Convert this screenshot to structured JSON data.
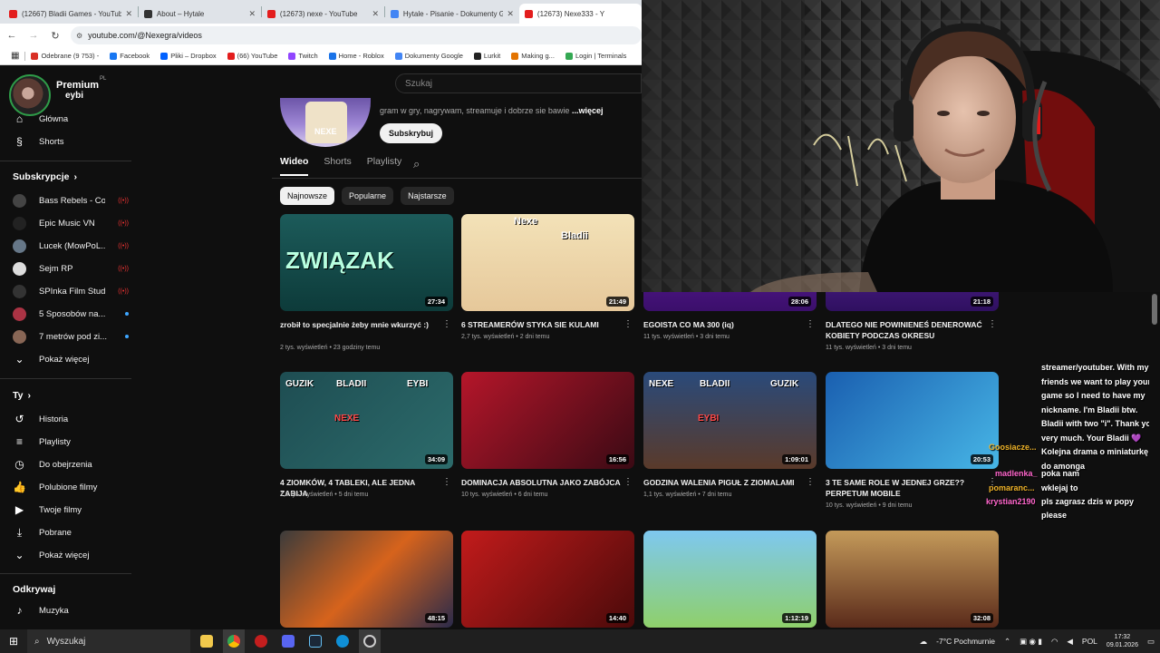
{
  "browser": {
    "tabs": [
      {
        "title": "(12667) Bladii Games - YouTube",
        "color": "#e31d1d",
        "active": false
      },
      {
        "title": "About – Hytale",
        "color": "#333333",
        "active": false
      },
      {
        "title": "(12673) nexe - YouTube",
        "color": "#e31d1d",
        "active": false
      },
      {
        "title": "Hytale - Pisanie - Dokumenty G",
        "color": "#4285f4",
        "active": false
      },
      {
        "title": "(12673) Nexe333 - Y",
        "color": "#e31d1d",
        "active": true
      }
    ],
    "url": "youtube.com/@Nexegra/videos",
    "bookmarks": [
      {
        "label": "Odebrane (9 753) -",
        "color": "#d93025"
      },
      {
        "label": "Facebook",
        "color": "#1877f2"
      },
      {
        "label": "Pliki – Dropbox",
        "color": "#0061ff"
      },
      {
        "label": "(66) YouTube",
        "color": "#e31d1d"
      },
      {
        "label": "Twitch",
        "color": "#9146ff"
      },
      {
        "label": "Home - Roblox",
        "color": "#1a73e8"
      },
      {
        "label": "Dokumenty Google",
        "color": "#4285f4"
      },
      {
        "label": "Lurkit",
        "color": "#222222"
      },
      {
        "label": "Making g...",
        "color": "#e37400"
      },
      {
        "label": "Login | Terminals",
        "color": "#34a853"
      }
    ]
  },
  "youtube": {
    "logo_text": "Premium",
    "logo_sub": "eybi",
    "region": "PL",
    "search_placeholder": "Szukaj",
    "nav": [
      {
        "label": "Główna",
        "icon": "home-icon"
      },
      {
        "label": "Shorts",
        "icon": "shorts-icon"
      }
    ],
    "subscriptions_header": "Subskrypcje",
    "subscriptions": [
      {
        "label": "Bass Rebels - Co...",
        "color": "#444444",
        "indicator": "live"
      },
      {
        "label": "Epic Music VN",
        "color": "#222222",
        "indicator": "live"
      },
      {
        "label": "Lucek (MowPoL...",
        "color": "#667788",
        "indicator": "live"
      },
      {
        "label": "Sejm RP",
        "color": "#dddddd",
        "indicator": "live"
      },
      {
        "label": "SPInka Film Stud...",
        "color": "#333333",
        "indicator": "live"
      },
      {
        "label": "5 Sposobów na...",
        "color": "#aa3344",
        "indicator": "new"
      },
      {
        "label": "7 metrów pod zi...",
        "color": "#886655",
        "indicator": "new"
      }
    ],
    "show_more_1": "Pokaż więcej",
    "you_header": "Ty",
    "you_items": [
      {
        "label": "Historia",
        "icon": "history-icon"
      },
      {
        "label": "Playlisty",
        "icon": "playlist-icon"
      },
      {
        "label": "Do obejrzenia",
        "icon": "watch-later-icon"
      },
      {
        "label": "Polubione filmy",
        "icon": "like-icon"
      },
      {
        "label": "Twoje filmy",
        "icon": "your-videos-icon"
      },
      {
        "label": "Pobrane",
        "icon": "download-icon"
      }
    ],
    "show_more_2": "Pokaż więcej",
    "explore_header": "Odkrywaj",
    "explore_items": [
      {
        "label": "Muzyka",
        "icon": "music-icon"
      }
    ],
    "channel": {
      "art_text": "NEXE",
      "description": "gram w gry, nagrywam, streamuje i dobrze sie bawie",
      "more": "...więcej",
      "subscribe": "Subskrybuj"
    },
    "tabs": [
      "Wideo",
      "Shorts",
      "Playlisty"
    ],
    "chips": [
      "Najnowsze",
      "Popularne",
      "Najstarsze"
    ],
    "videos": [
      {
        "title": "zrobił to specjalnie żeby mnie wkurzyć :)",
        "views": "2 tys. wyświetleń",
        "age": "23 godziny temu",
        "duration": "27:34",
        "thumb_text": "ZWIĄZAK"
      },
      {
        "title": "6 STREAMERÓW STYKA SIE KULAMI",
        "views": "2,7 tys. wyświetleń",
        "age": "2 dni temu",
        "duration": "21:49",
        "thumb_text": "Nexe",
        "thumb_text_2": "Bladii"
      },
      {
        "title": "EGOISTA CO MA 300 (iq)",
        "views": "11 tys. wyświetleń",
        "age": "3 dni temu",
        "duration": "28:06"
      },
      {
        "title": "DLATEGO NIE POWINIENEŚ DENEROWAĆ KOBIETY PODCZAS OKRESU",
        "views": "11 tys. wyświetleń",
        "age": "3 dni temu",
        "duration": "21:18"
      },
      {
        "title": "4 ZIOMKÓW, 4 TABLEKI, ALE JEDNA ZABIJA",
        "views": "1,3 tys. wyświetleń",
        "age": "5 dni temu",
        "duration": "34:09",
        "thumb_text": "GUZIK",
        "thumb_text_2": "BLADII",
        "thumb_text_3": "EYBI",
        "thumb_text_4": "NEXE"
      },
      {
        "title": "DOMINACJA ABSOLUTNA JAKO ZABÓJCA",
        "views": "10 tys. wyświetleń",
        "age": "6 dni temu",
        "duration": "16:56"
      },
      {
        "title": "GODZINA WALENIA PIGUŁ Z ZIOMALAMI",
        "views": "1,1 tys. wyświetleń",
        "age": "7 dni temu",
        "duration": "1:09:01",
        "thumb_text": "NEXE",
        "thumb_text_2": "BLADII",
        "thumb_text_3": "GUZIK",
        "thumb_text_4": "EYBI"
      },
      {
        "title": "3 TE SAME ROLE W JEDNEJ GRZE?? PERPETUM MOBILE",
        "views": "10 tys. wyświetleń",
        "age": "9 dni temu",
        "duration": "20:53"
      },
      {
        "duration": "48:15"
      },
      {
        "duration": "14:40"
      },
      {
        "duration": "1:12:19"
      },
      {
        "duration": "32:08"
      }
    ]
  },
  "chat": {
    "message_lines": [
      "streamer/youtuber. With my",
      "friends we want to play your",
      "game so I need to have my",
      "nickname. I'm Bladii btw.",
      "Bladii with two \"i\". Thank you",
      "very much. Your Bladii 💜",
      "Kolejna drama o miniaturkę",
      "do amonga"
    ],
    "entries": [
      {
        "user": "Goosiacze...",
        "color": "#f0b429",
        "message": ""
      },
      {
        "user": "madlenka_",
        "color": "#ff66cc",
        "message": "poka nam"
      },
      {
        "user": "pomaranc...",
        "color": "#f0b429",
        "message": "wklejaj to"
      },
      {
        "user": "krystian2190",
        "color": "#ff66cc",
        "message": "pls zagrasz dzis w popy"
      }
    ],
    "trailing_line": "please"
  },
  "taskbar": {
    "search_label": "Wyszukaj",
    "weather": "-7°C Pochmurnie",
    "lang": "POL",
    "time": "17:32",
    "date": "09.01.2026"
  }
}
